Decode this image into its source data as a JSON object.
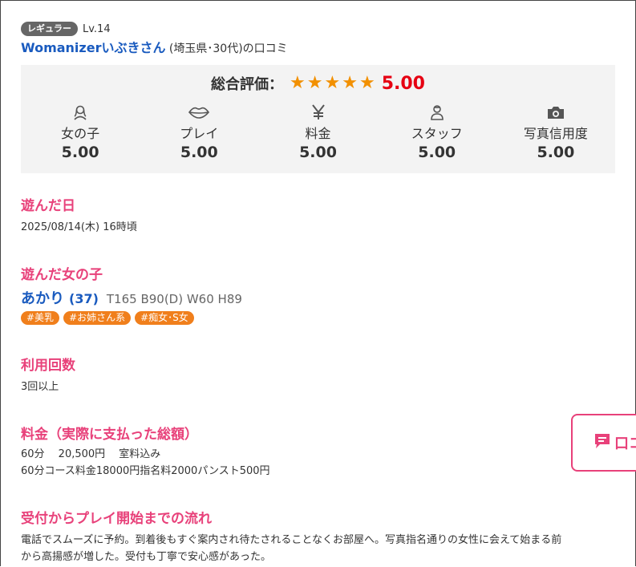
{
  "reviewer": {
    "badge": "レギュラー",
    "level": "Lv.14",
    "name": "Womanizerいぶきさん",
    "meta": " (埼玉県･30代)の口コミ"
  },
  "rating": {
    "overall_label": "総合評価：",
    "overall_stars": 5,
    "overall_score": "5.00",
    "categories": [
      {
        "label": "女の子",
        "score": "5.00",
        "icon": "girl-icon"
      },
      {
        "label": "プレイ",
        "score": "5.00",
        "icon": "lips-icon"
      },
      {
        "label": "料金",
        "score": "5.00",
        "icon": "yen-icon"
      },
      {
        "label": "スタッフ",
        "score": "5.00",
        "icon": "staff-icon"
      },
      {
        "label": "写真信用度",
        "score": "5.00",
        "icon": "camera-icon"
      }
    ]
  },
  "sections": {
    "visit_date": {
      "title": "遊んだ日",
      "text": "2025/08/14(木) 16時頃"
    },
    "girl": {
      "title": "遊んだ女の子",
      "name": "あかり",
      "age": "(37)",
      "specs": "T165 B90(D) W60 H89",
      "tags": [
        "#美乳",
        "#お姉さん系",
        "#痴女･S女"
      ]
    },
    "usage_count": {
      "title": "利用回数",
      "text": "3回以上"
    },
    "price": {
      "title": "料金（実際に支払った総額）",
      "line1": "60分　 20,500円　 室料込み",
      "line2": "60分コース料金18000円指名料2000パンスト500円"
    },
    "flow": {
      "title": "受付からプレイ開始までの流れ",
      "line1": "電話でスムーズに予約。到着後もすぐ案内され待たされることなくお部屋へ。写真指名通りの女性に会えて始まる前",
      "line2": "から高揚感が増した。受付も丁寧で安心感があった。"
    }
  },
  "side_tab": {
    "label": "口コ",
    "icon": "comment-icon"
  },
  "colors": {
    "accent": "#e8417a",
    "link": "#1a5bbf",
    "star": "#f29000",
    "score": "#e60012",
    "tag": "#f07f1c"
  }
}
